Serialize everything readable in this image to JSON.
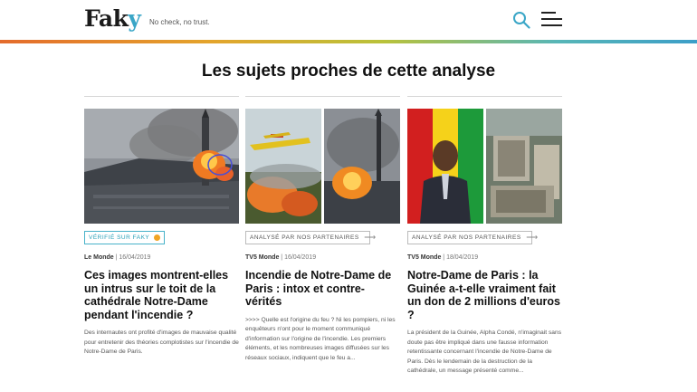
{
  "header": {
    "logo_main": "Fak",
    "logo_accent": "y",
    "tagline": "No check, no trust.",
    "search_icon": "search-icon",
    "menu_icon": "hamburger-menu-icon"
  },
  "colors": {
    "accent": "#3aa6c7",
    "badge_dot": "#f0a424",
    "gradient": [
      "#e46b2c",
      "#e4a42c",
      "#b9c23a",
      "#57b6b7",
      "#3c9ec8"
    ]
  },
  "section": {
    "title": "Les sujets proches de cette analyse"
  },
  "cards": [
    {
      "badge": "Vérifié sur Faky",
      "source": "Le Monde",
      "date": "16/04/2019",
      "headline": "Ces images montrent-elles un intrus sur le toit de la cathédrale Notre-Dame pendant l'incendie ?",
      "excerpt": "Des internautes ont profité d'images de mauvaise qualité pour entretenir des théories complotistes sur l'incendie de Notre-Dame de Paris."
    },
    {
      "badge": "Analysé par nos partenaires",
      "source": "TV5 Monde",
      "date": "16/04/2019",
      "headline": "Incendie de Notre-Dame de Paris : intox et contre-vérités",
      "excerpt": ">>>> Quelle est l'origine du feu ? Ni les pompiers, ni les enquêteurs n'ont pour le moment communiqué d'information sur l'origine de l'incendie. Les premiers éléments, et les nombreuses images diffusées sur les réseaux sociaux, indiquent que le feu a..."
    },
    {
      "badge": "Analysé par nos partenaires",
      "source": "TV5 Monde",
      "date": "18/04/2019",
      "headline": "Notre-Dame de Paris : la Guinée a-t-elle vraiment fait un don de 2 millions d'euros ?",
      "excerpt": "La président de la Guinée, Alpha Condé, n'imaginait sans doute pas être impliqué dans une fausse information retentissante concernant l'incendie de Notre-Dame de Paris. Dès le lendemain de la destruction de la cathédrale, un message présenté comme..."
    }
  ]
}
